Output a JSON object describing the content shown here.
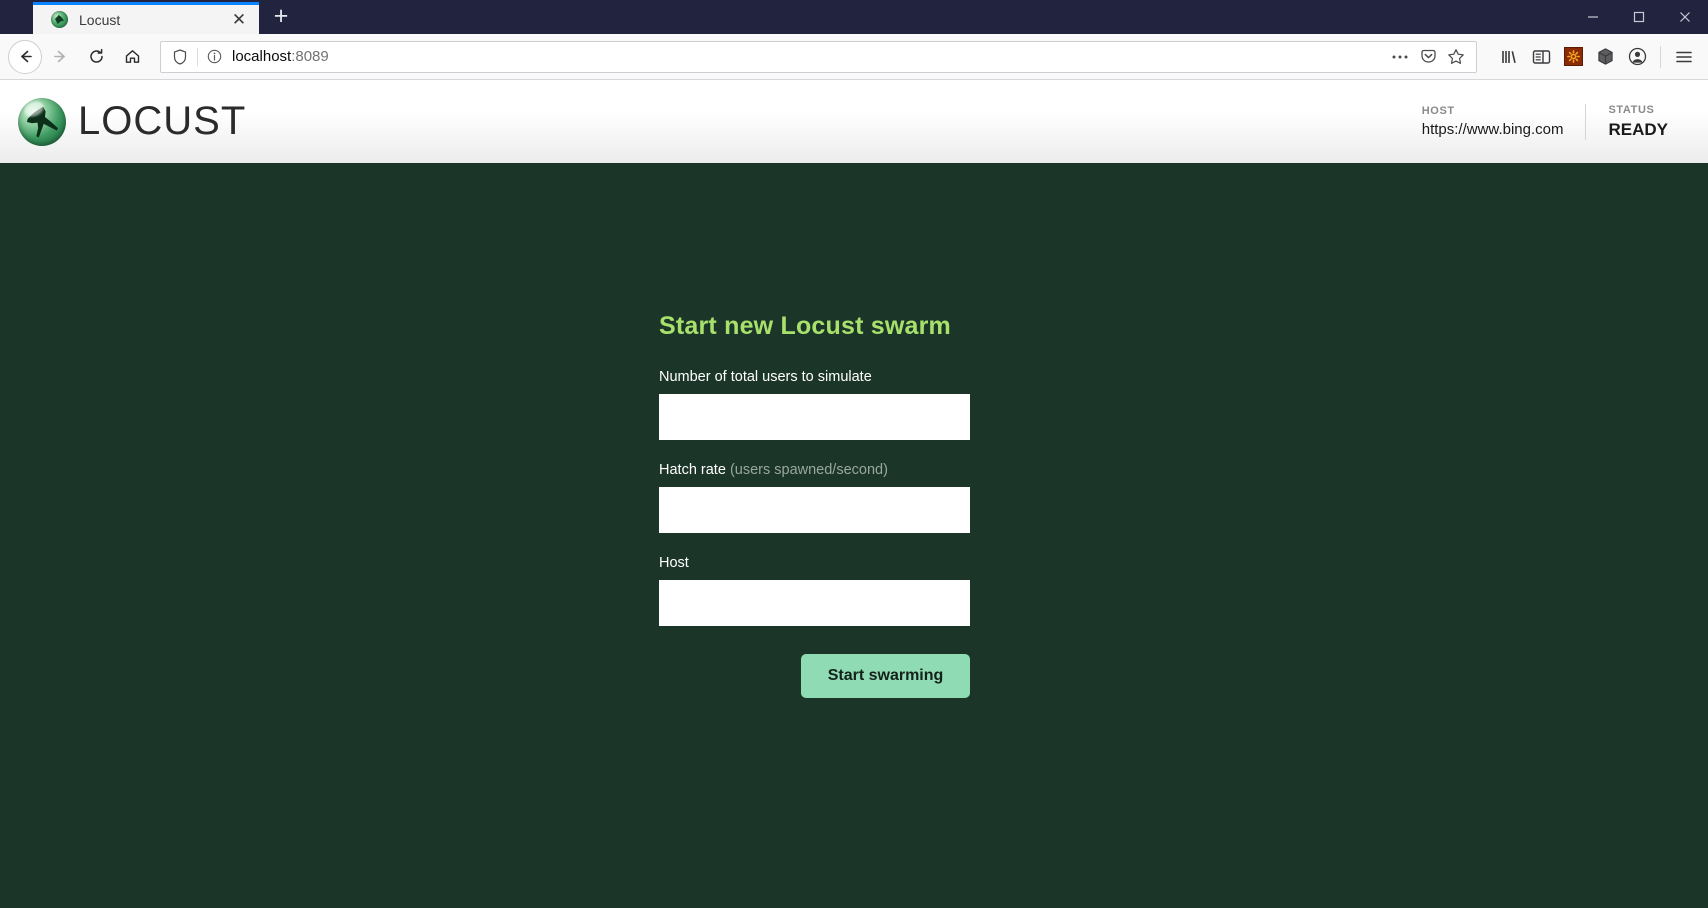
{
  "browser": {
    "tab": {
      "title": "Locust",
      "favicon": "locust-favicon",
      "close_label": "✕"
    },
    "newtab_label": "+",
    "window_controls": {
      "minimize": "minimize-icon",
      "maximize": "maximize-icon",
      "close": "close-icon"
    },
    "nav": {
      "back": "back-arrow-icon",
      "forward": "forward-arrow-icon",
      "reload": "reload-icon",
      "home": "home-icon"
    },
    "urlbar": {
      "shield": "shield-icon",
      "info": "info-circle-icon",
      "url_host": "localhost",
      "url_port": ":8089",
      "page_actions": "ellipsis-icon",
      "pocket": "pocket-icon",
      "bookmark": "star-icon"
    },
    "toolbar_right": {
      "library": "library-icon",
      "sidebar": "sidebar-icon",
      "extension": "gear-extension-icon",
      "container": "cube-icon",
      "account": "account-circle-icon",
      "menu": "hamburger-menu-icon"
    }
  },
  "app": {
    "brand_name": "LOCUST",
    "brand_logo": "locust-logo",
    "stats": [
      {
        "label": "HOST",
        "value": "https://www.bing.com",
        "emphasis": false
      },
      {
        "label": "STATUS",
        "value": "READY",
        "emphasis": true
      }
    ]
  },
  "form": {
    "title": "Start new Locust swarm",
    "fields": [
      {
        "label": "Number of total users to simulate",
        "hint": "",
        "value": "",
        "placeholder": ""
      },
      {
        "label": "Hatch rate",
        "hint": "(users spawned/second)",
        "value": "",
        "placeholder": ""
      },
      {
        "label": "Host",
        "hint": "",
        "value": "",
        "placeholder": ""
      }
    ],
    "submit_label": "Start swarming"
  },
  "colors": {
    "page_bg": "#1b3529",
    "title_green": "#a8e06c",
    "button_green": "#8fdcb4",
    "titlebar": "#22243f",
    "tab_accent": "#0a84ff"
  }
}
